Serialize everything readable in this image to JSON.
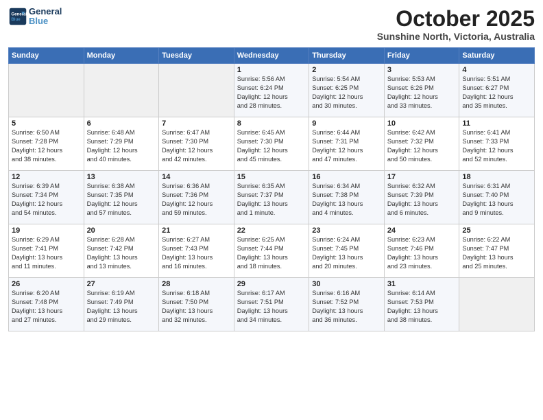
{
  "header": {
    "logo_line1": "General",
    "logo_line2": "Blue",
    "month": "October 2025",
    "location": "Sunshine North, Victoria, Australia"
  },
  "weekdays": [
    "Sunday",
    "Monday",
    "Tuesday",
    "Wednesday",
    "Thursday",
    "Friday",
    "Saturday"
  ],
  "weeks": [
    [
      {
        "day": "",
        "info": ""
      },
      {
        "day": "",
        "info": ""
      },
      {
        "day": "",
        "info": ""
      },
      {
        "day": "1",
        "info": "Sunrise: 5:56 AM\nSunset: 6:24 PM\nDaylight: 12 hours\nand 28 minutes."
      },
      {
        "day": "2",
        "info": "Sunrise: 5:54 AM\nSunset: 6:25 PM\nDaylight: 12 hours\nand 30 minutes."
      },
      {
        "day": "3",
        "info": "Sunrise: 5:53 AM\nSunset: 6:26 PM\nDaylight: 12 hours\nand 33 minutes."
      },
      {
        "day": "4",
        "info": "Sunrise: 5:51 AM\nSunset: 6:27 PM\nDaylight: 12 hours\nand 35 minutes."
      }
    ],
    [
      {
        "day": "5",
        "info": "Sunrise: 6:50 AM\nSunset: 7:28 PM\nDaylight: 12 hours\nand 38 minutes."
      },
      {
        "day": "6",
        "info": "Sunrise: 6:48 AM\nSunset: 7:29 PM\nDaylight: 12 hours\nand 40 minutes."
      },
      {
        "day": "7",
        "info": "Sunrise: 6:47 AM\nSunset: 7:30 PM\nDaylight: 12 hours\nand 42 minutes."
      },
      {
        "day": "8",
        "info": "Sunrise: 6:45 AM\nSunset: 7:30 PM\nDaylight: 12 hours\nand 45 minutes."
      },
      {
        "day": "9",
        "info": "Sunrise: 6:44 AM\nSunset: 7:31 PM\nDaylight: 12 hours\nand 47 minutes."
      },
      {
        "day": "10",
        "info": "Sunrise: 6:42 AM\nSunset: 7:32 PM\nDaylight: 12 hours\nand 50 minutes."
      },
      {
        "day": "11",
        "info": "Sunrise: 6:41 AM\nSunset: 7:33 PM\nDaylight: 12 hours\nand 52 minutes."
      }
    ],
    [
      {
        "day": "12",
        "info": "Sunrise: 6:39 AM\nSunset: 7:34 PM\nDaylight: 12 hours\nand 54 minutes."
      },
      {
        "day": "13",
        "info": "Sunrise: 6:38 AM\nSunset: 7:35 PM\nDaylight: 12 hours\nand 57 minutes."
      },
      {
        "day": "14",
        "info": "Sunrise: 6:36 AM\nSunset: 7:36 PM\nDaylight: 12 hours\nand 59 minutes."
      },
      {
        "day": "15",
        "info": "Sunrise: 6:35 AM\nSunset: 7:37 PM\nDaylight: 13 hours\nand 1 minute."
      },
      {
        "day": "16",
        "info": "Sunrise: 6:34 AM\nSunset: 7:38 PM\nDaylight: 13 hours\nand 4 minutes."
      },
      {
        "day": "17",
        "info": "Sunrise: 6:32 AM\nSunset: 7:39 PM\nDaylight: 13 hours\nand 6 minutes."
      },
      {
        "day": "18",
        "info": "Sunrise: 6:31 AM\nSunset: 7:40 PM\nDaylight: 13 hours\nand 9 minutes."
      }
    ],
    [
      {
        "day": "19",
        "info": "Sunrise: 6:29 AM\nSunset: 7:41 PM\nDaylight: 13 hours\nand 11 minutes."
      },
      {
        "day": "20",
        "info": "Sunrise: 6:28 AM\nSunset: 7:42 PM\nDaylight: 13 hours\nand 13 minutes."
      },
      {
        "day": "21",
        "info": "Sunrise: 6:27 AM\nSunset: 7:43 PM\nDaylight: 13 hours\nand 16 minutes."
      },
      {
        "day": "22",
        "info": "Sunrise: 6:25 AM\nSunset: 7:44 PM\nDaylight: 13 hours\nand 18 minutes."
      },
      {
        "day": "23",
        "info": "Sunrise: 6:24 AM\nSunset: 7:45 PM\nDaylight: 13 hours\nand 20 minutes."
      },
      {
        "day": "24",
        "info": "Sunrise: 6:23 AM\nSunset: 7:46 PM\nDaylight: 13 hours\nand 23 minutes."
      },
      {
        "day": "25",
        "info": "Sunrise: 6:22 AM\nSunset: 7:47 PM\nDaylight: 13 hours\nand 25 minutes."
      }
    ],
    [
      {
        "day": "26",
        "info": "Sunrise: 6:20 AM\nSunset: 7:48 PM\nDaylight: 13 hours\nand 27 minutes."
      },
      {
        "day": "27",
        "info": "Sunrise: 6:19 AM\nSunset: 7:49 PM\nDaylight: 13 hours\nand 29 minutes."
      },
      {
        "day": "28",
        "info": "Sunrise: 6:18 AM\nSunset: 7:50 PM\nDaylight: 13 hours\nand 32 minutes."
      },
      {
        "day": "29",
        "info": "Sunrise: 6:17 AM\nSunset: 7:51 PM\nDaylight: 13 hours\nand 34 minutes."
      },
      {
        "day": "30",
        "info": "Sunrise: 6:16 AM\nSunset: 7:52 PM\nDaylight: 13 hours\nand 36 minutes."
      },
      {
        "day": "31",
        "info": "Sunrise: 6:14 AM\nSunset: 7:53 PM\nDaylight: 13 hours\nand 38 minutes."
      },
      {
        "day": "",
        "info": ""
      }
    ]
  ]
}
